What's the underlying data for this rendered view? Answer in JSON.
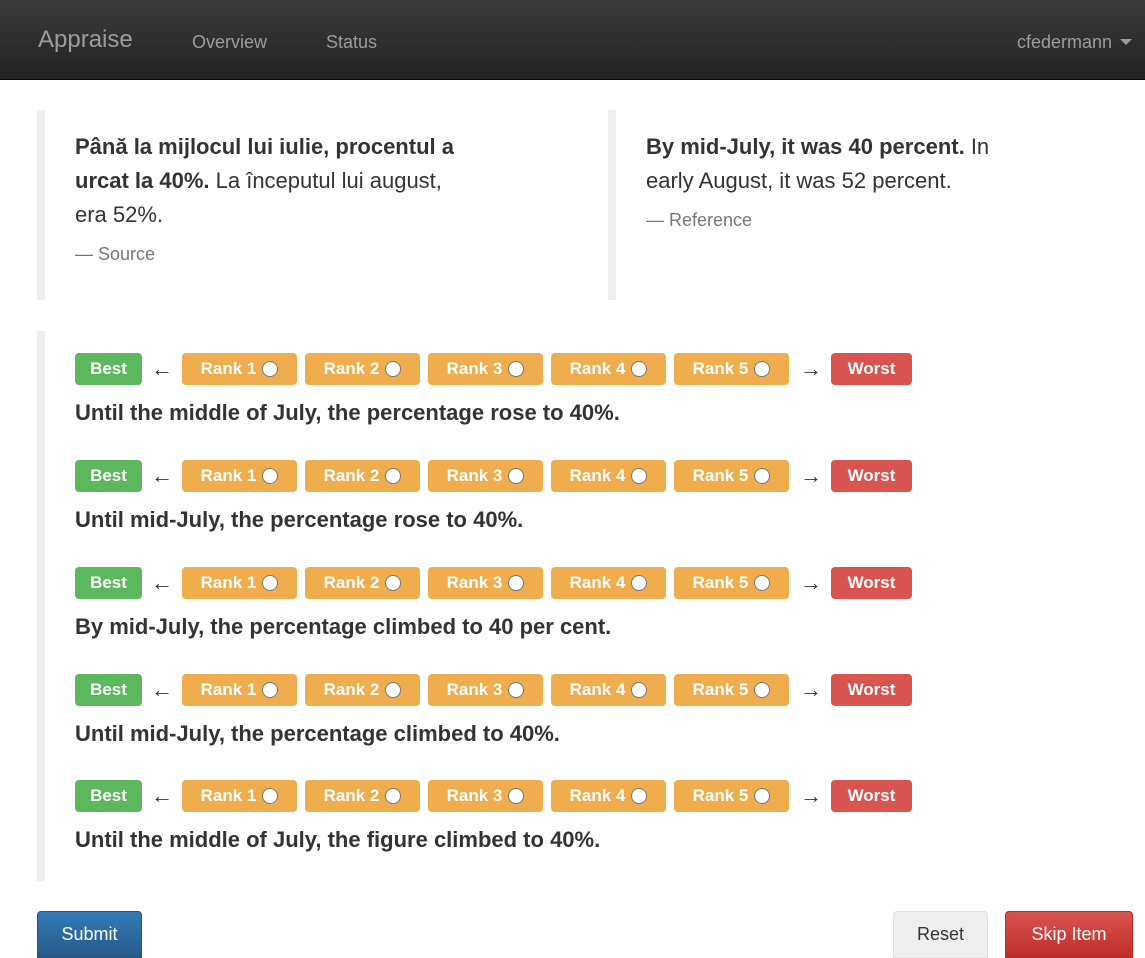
{
  "navbar": {
    "brand": "Appraise",
    "links": [
      "Overview",
      "Status"
    ],
    "user": "cfedermann"
  },
  "source": {
    "bold_text": "Până la mijlocul lui iulie, procentul a urcat la 40%.",
    "rest_text": " La începutul lui august, era 52%.",
    "cite": "— Source"
  },
  "reference": {
    "bold_text": "By mid-July, it was 40 percent.",
    "rest_text": " In early August, it was 52 percent.",
    "cite": "— Reference"
  },
  "ranking": {
    "best_label": "Best",
    "worst_label": "Worst",
    "left_arrow": "←",
    "right_arrow": "→",
    "rank_labels": [
      "Rank 1",
      "Rank 2",
      "Rank 3",
      "Rank 4",
      "Rank 5"
    ],
    "translations": [
      "Until the middle of July, the percentage rose to 40%.",
      "Until mid-July, the percentage rose to 40%.",
      "By mid-July, the percentage climbed to 40 per cent.",
      "Until mid-July, the percentage climbed to 40%.",
      "Until the middle of July, the figure climbed to 40%."
    ]
  },
  "buttons": {
    "submit": "Submit",
    "reset": "Reset",
    "skip": "Skip Item"
  },
  "colors": {
    "best": "#5cb85c",
    "worst": "#d9534f",
    "rank": "#f0ad4e",
    "primary": "#337ab7"
  }
}
